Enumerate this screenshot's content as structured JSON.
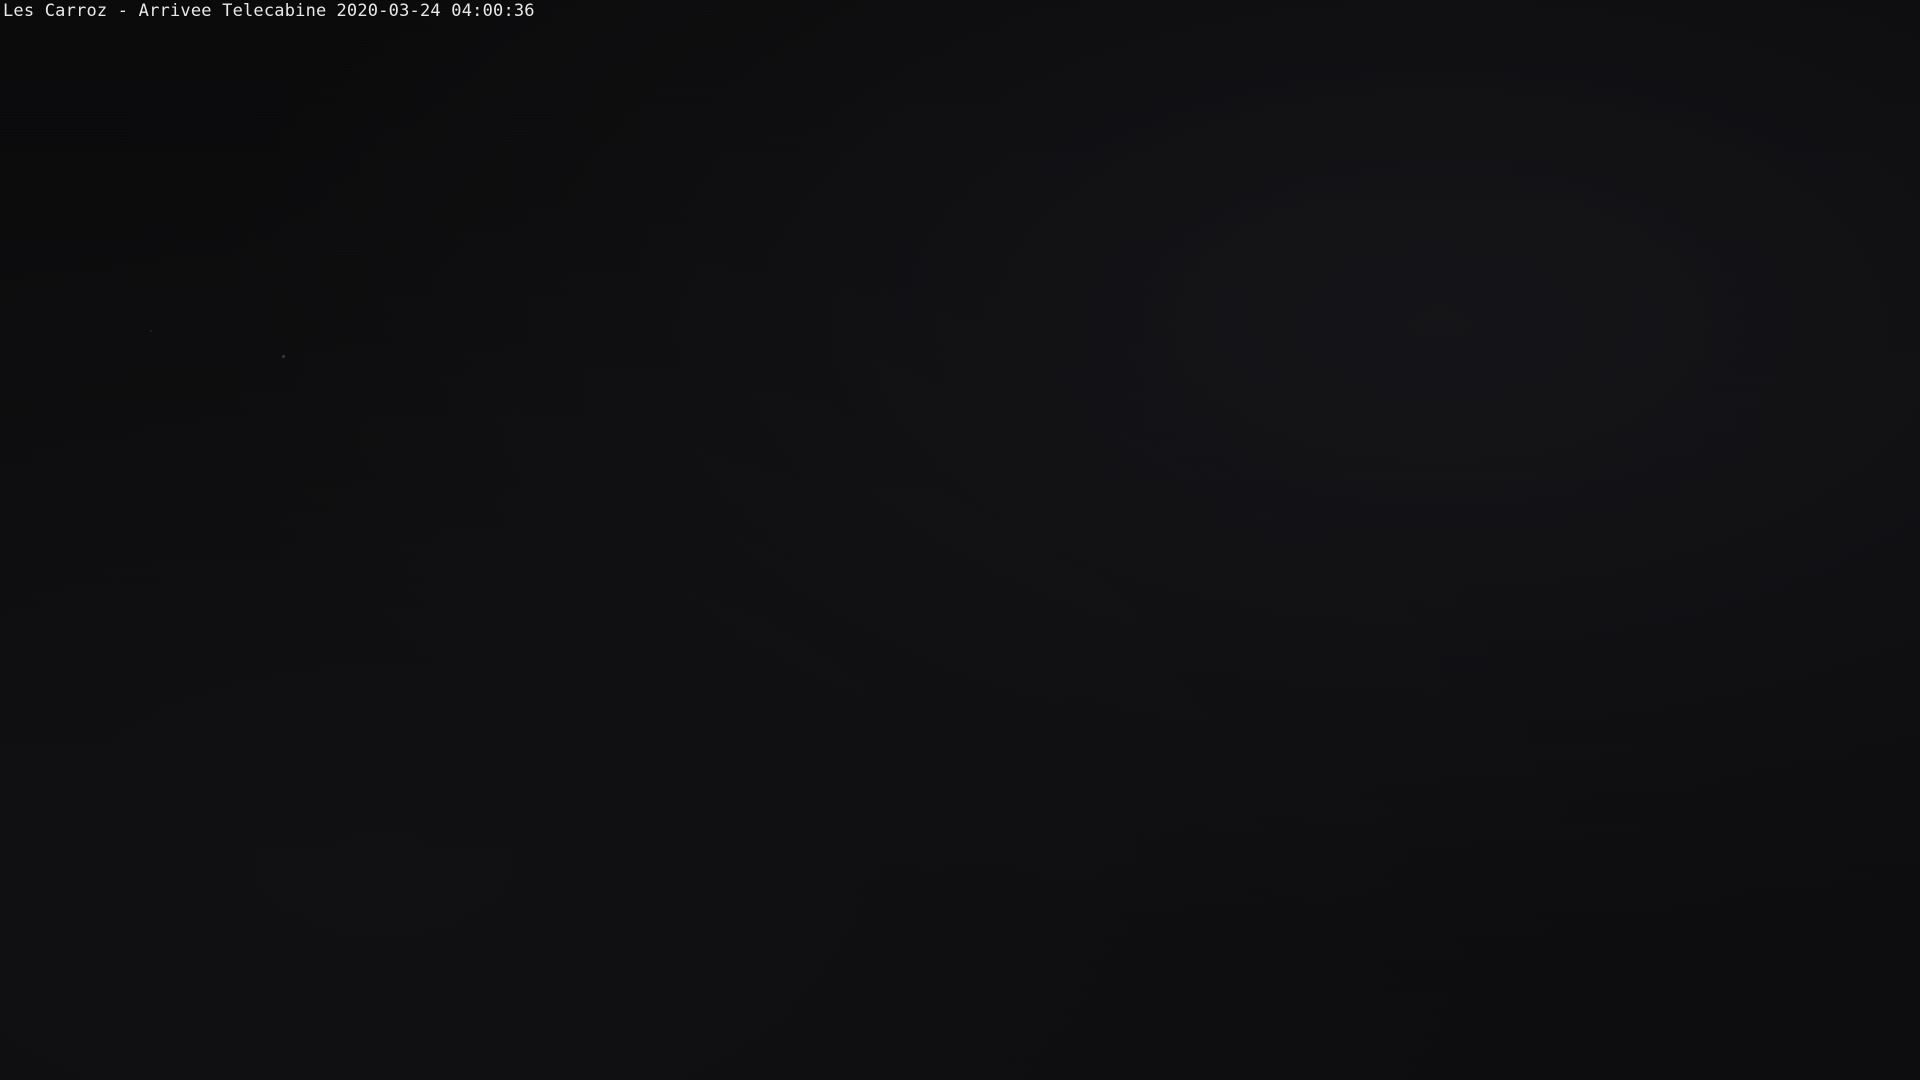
{
  "webcam": {
    "location": "Les Carroz - Arrivee Telecabine",
    "timestamp": "2020-03-24 04:00:36"
  }
}
